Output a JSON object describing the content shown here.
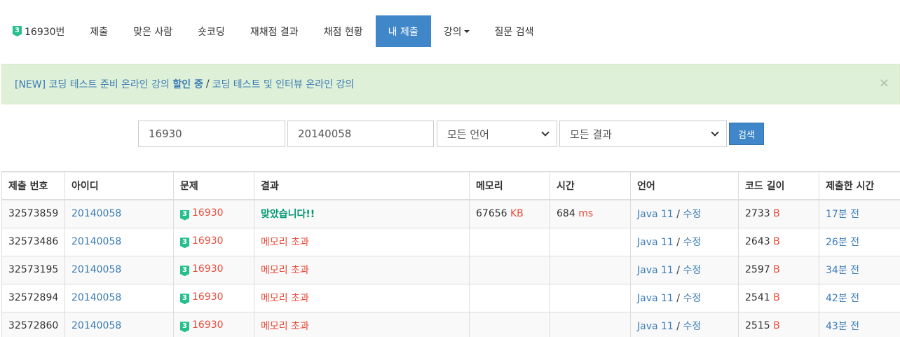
{
  "nav": {
    "problem_tier": "3",
    "items": [
      {
        "label": "16930번"
      },
      {
        "label": "제출"
      },
      {
        "label": "맞은 사람"
      },
      {
        "label": "숏코딩"
      },
      {
        "label": "재채점 결과"
      },
      {
        "label": "채점 현황"
      },
      {
        "label": "내 제출"
      },
      {
        "label": "강의"
      },
      {
        "label": "질문 검색"
      }
    ],
    "active_index": 6
  },
  "alert": {
    "part1": "[NEW] 코딩 테스트 준비 온라인 강의 ",
    "highlight": "할인 중",
    "separator": "/",
    "part2": "코딩 테스트 및 인터뷰 온라인 강의",
    "close": "×"
  },
  "search": {
    "problem_id": "16930",
    "user_id": "20140058",
    "language": "모든 언어",
    "result": "모든 결과",
    "button": "검색"
  },
  "table": {
    "headers": [
      "제출 번호",
      "아이디",
      "문제",
      "결과",
      "메모리",
      "시간",
      "언어",
      "코드 길이",
      "제출한 시간"
    ],
    "rows": [
      {
        "id": "32573859",
        "user": "20140058",
        "tier": "3",
        "problem": "16930",
        "result": "맞았습니다!!",
        "memory": "67656",
        "memory_unit": "KB",
        "time": "684",
        "time_unit": "ms",
        "lang": "Java 11",
        "edit": "수정",
        "code_len": "2733",
        "code_unit": "B",
        "submitted": "17분 전"
      },
      {
        "id": "32573486",
        "user": "20140058",
        "tier": "3",
        "problem": "16930",
        "result": "메모리 초과",
        "memory": "",
        "memory_unit": "",
        "time": "",
        "time_unit": "",
        "lang": "Java 11",
        "edit": "수정",
        "code_len": "2643",
        "code_unit": "B",
        "submitted": "26분 전"
      },
      {
        "id": "32573195",
        "user": "20140058",
        "tier": "3",
        "problem": "16930",
        "result": "메모리 초과",
        "memory": "",
        "memory_unit": "",
        "time": "",
        "time_unit": "",
        "lang": "Java 11",
        "edit": "수정",
        "code_len": "2597",
        "code_unit": "B",
        "submitted": "34분 전"
      },
      {
        "id": "32572894",
        "user": "20140058",
        "tier": "3",
        "problem": "16930",
        "result": "메모리 초과",
        "memory": "",
        "memory_unit": "",
        "time": "",
        "time_unit": "",
        "lang": "Java 11",
        "edit": "수정",
        "code_len": "2541",
        "code_unit": "B",
        "submitted": "42분 전"
      },
      {
        "id": "32572860",
        "user": "20140058",
        "tier": "3",
        "problem": "16930",
        "result": "메모리 초과",
        "memory": "",
        "memory_unit": "",
        "time": "",
        "time_unit": "",
        "lang": "Java 11",
        "edit": "수정",
        "code_len": "2515",
        "code_unit": "B",
        "submitted": "43분 전"
      }
    ]
  },
  "colors": {
    "primary": "#3f87c8",
    "accepted": "#009874",
    "error": "#e74c3c",
    "tier_badge": "#27bf8d",
    "alert_bg": "#dff0d8"
  }
}
